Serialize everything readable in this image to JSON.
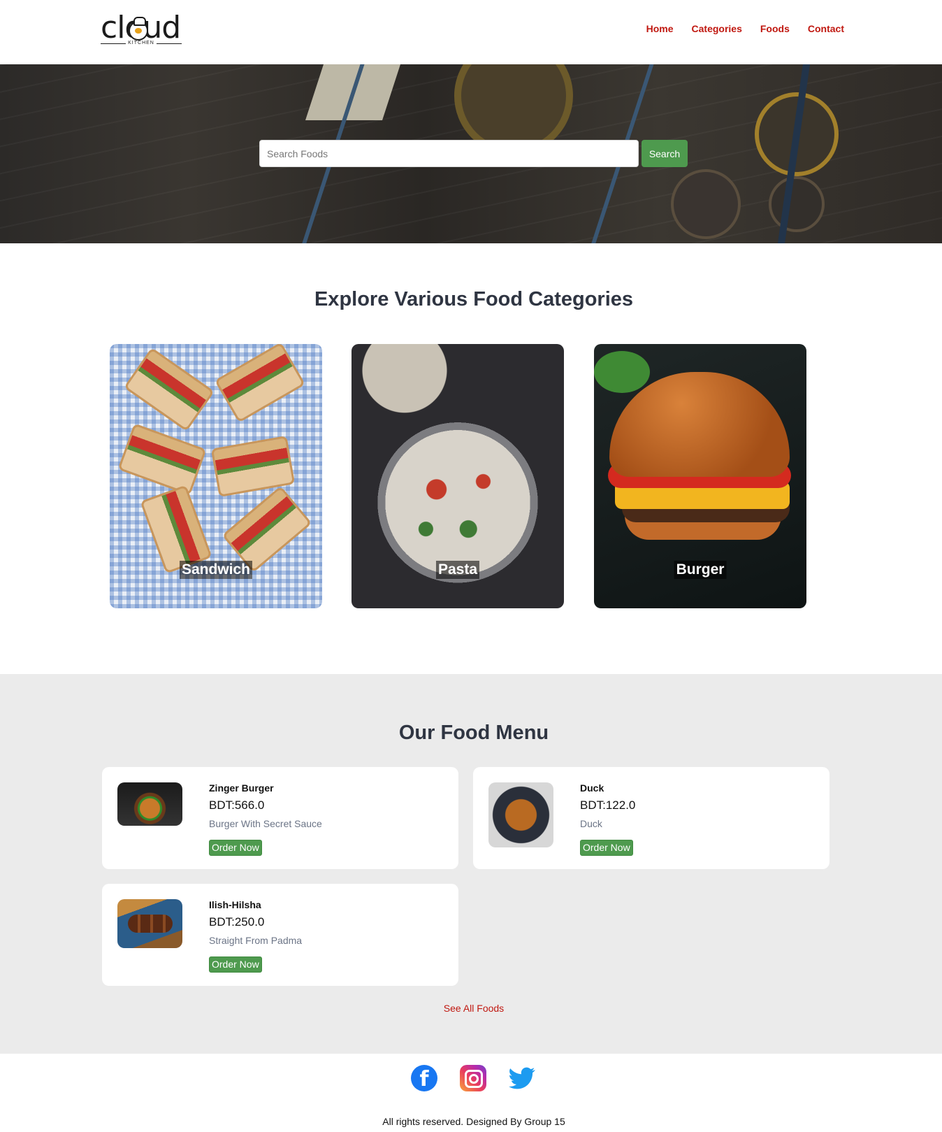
{
  "brand": {
    "logo_word": "cloud",
    "logo_sub": "KITCHEN"
  },
  "nav": {
    "items": [
      {
        "label": "Home"
      },
      {
        "label": "Categories"
      },
      {
        "label": "Foods"
      },
      {
        "label": "Contact"
      }
    ]
  },
  "hero": {
    "search_placeholder": "Search Foods",
    "search_button": "Search"
  },
  "categories": {
    "title": "Explore Various Food Categories",
    "items": [
      {
        "name": "Sandwich"
      },
      {
        "name": "Pasta"
      },
      {
        "name": "Burger"
      }
    ]
  },
  "menu": {
    "title": "Our Food Menu",
    "items": [
      {
        "name": "Zinger Burger",
        "price": "BDT:566.0",
        "description": "Burger With Secret Sauce",
        "button": "Order Now"
      },
      {
        "name": "Duck",
        "price": "BDT:122.0",
        "description": "Duck",
        "button": "Order Now"
      },
      {
        "name": "Ilish-Hilsha",
        "price": "BDT:250.0",
        "description": "Straight From Padma",
        "button": "Order Now"
      }
    ],
    "see_all": "See All Foods"
  },
  "footer": {
    "socials": [
      "facebook-icon",
      "instagram-icon",
      "twitter-icon"
    ],
    "facebook_glyph": "f",
    "copyright": "All rights reserved. Designed By Group 15"
  },
  "colors": {
    "accent_red": "#c01810",
    "button_green": "#4e9a4e",
    "heading": "#2f3542",
    "menu_bg": "#ebebeb"
  }
}
